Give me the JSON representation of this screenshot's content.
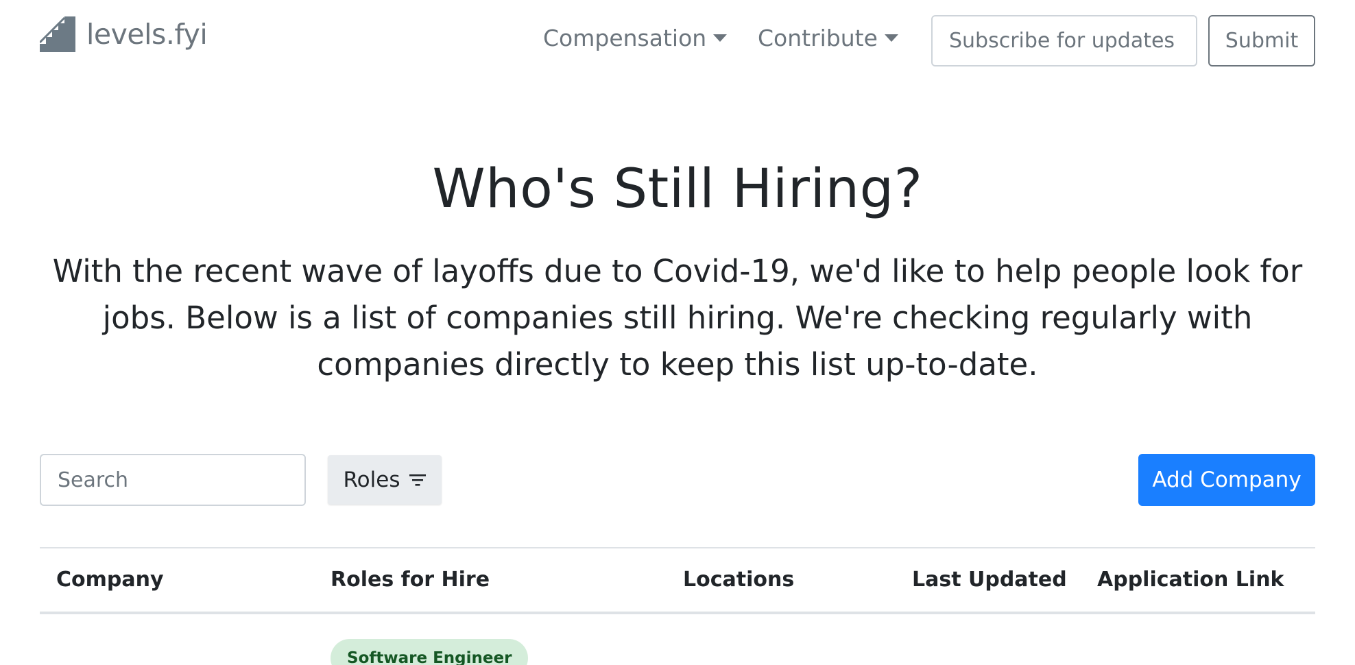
{
  "navbar": {
    "brand": "levels.fyi",
    "menu": [
      {
        "label": "Compensation"
      },
      {
        "label": "Contribute"
      }
    ],
    "subscribe": {
      "placeholder": "Subscribe for updates",
      "value": ""
    },
    "submit_label": "Submit"
  },
  "hero": {
    "title": "Who's Still Hiring?",
    "text": "With the recent wave of layoffs due to Covid-19, we'd like to help people look for jobs. Below is a list of companies still hiring. We're checking regularly with companies directly to keep this list up-to-date."
  },
  "controls": {
    "search": {
      "placeholder": "Search",
      "value": ""
    },
    "roles_label": "Roles",
    "add_label": "Add Company"
  },
  "table": {
    "columns": [
      "Company",
      "Roles for Hire",
      "Locations",
      "Last Updated",
      "Application Link"
    ],
    "rows": [
      {
        "company": "",
        "roles": [
          "Software Engineer"
        ],
        "locations": "",
        "last_updated": "",
        "application_link": ""
      }
    ]
  },
  "colors": {
    "primary": "#1a7fff",
    "muted_text": "#6c757d",
    "badge_bg": "#d4edda",
    "badge_text": "#155724"
  }
}
